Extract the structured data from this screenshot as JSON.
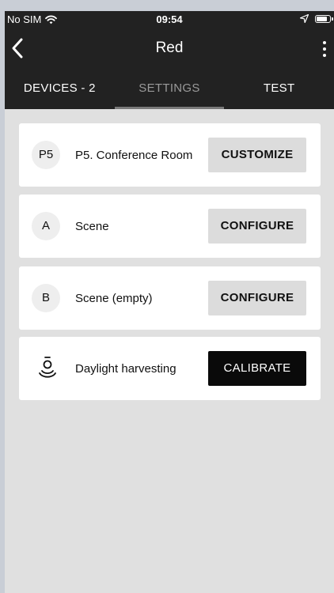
{
  "status_bar": {
    "carrier": "No SIM",
    "time": "09:54",
    "wifi_icon": "wifi-icon",
    "location_icon": "location-arrow-icon",
    "battery_icon": "battery-icon"
  },
  "nav": {
    "title": "Red",
    "back_icon": "chevron-left-icon",
    "more_icon": "more-vertical-icon"
  },
  "tabs": [
    {
      "label": "DEVICES - 2",
      "active": false
    },
    {
      "label": "SETTINGS",
      "active": true
    },
    {
      "label": "TEST",
      "active": false
    }
  ],
  "cards": [
    {
      "badge": "P5",
      "label": "P5. Conference Room",
      "button": "CUSTOMIZE"
    },
    {
      "badge": "A",
      "label": "Scene",
      "button": "CONFIGURE"
    },
    {
      "badge": "B",
      "label": "Scene (empty)",
      "button": "CONFIGURE"
    },
    {
      "icon": "daylight-sensor-icon",
      "label": "Daylight harvesting",
      "button": "CALIBRATE"
    }
  ],
  "colors": {
    "header_bg": "#222222",
    "content_bg": "#e0e0e0",
    "button_bg": "#dcdcdc",
    "primary_button_bg": "#0a0a0a"
  }
}
